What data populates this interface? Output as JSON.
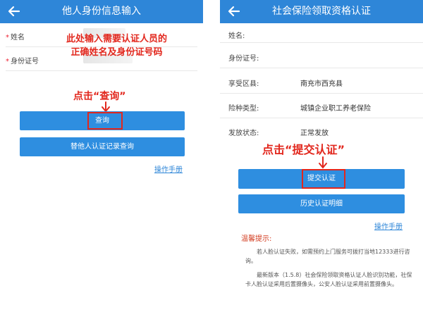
{
  "left": {
    "title": "他人身份信息输入",
    "fields": [
      {
        "label": "姓名"
      },
      {
        "label": "身份证号"
      }
    ],
    "annotation_fill": "此处输入需要认证人员的\n正确姓名及身份证号码",
    "annotation_query": "点击“查询”",
    "buttons": {
      "query": "查询",
      "history_query": "替他人认证记录查询"
    },
    "manual_link": "操作手册"
  },
  "right": {
    "title": "社会保险领取资格认证",
    "rows": [
      {
        "label": "姓名:",
        "value": ""
      },
      {
        "label": "身份证号:",
        "value": ""
      },
      {
        "label": "享受区县:",
        "value": "南充市西充县"
      },
      {
        "label": "险种类型:",
        "value": "城镇企业职工养老保险"
      },
      {
        "label": "发放状态:",
        "value": "正常发放"
      }
    ],
    "annotation_submit": "点击“提交认证”",
    "buttons": {
      "submit": "提交认证",
      "history": "历史认证明细"
    },
    "manual_link": "操作手册",
    "tips": {
      "title": "温馨提示:",
      "p1": "若人脸认证失败，如需预约上门服务可拨打当地12333进行咨询。",
      "p2": "最新版本（1.5.8）社会保险领取资格认证人脸识别功能，社保卡人脸认证采用后置摄像头，公安人脸认证采用前置摄像头。"
    }
  },
  "colors": {
    "appbar": "#2e86d8",
    "button": "#2e8ee0",
    "annotation_red": "#e2271d"
  }
}
